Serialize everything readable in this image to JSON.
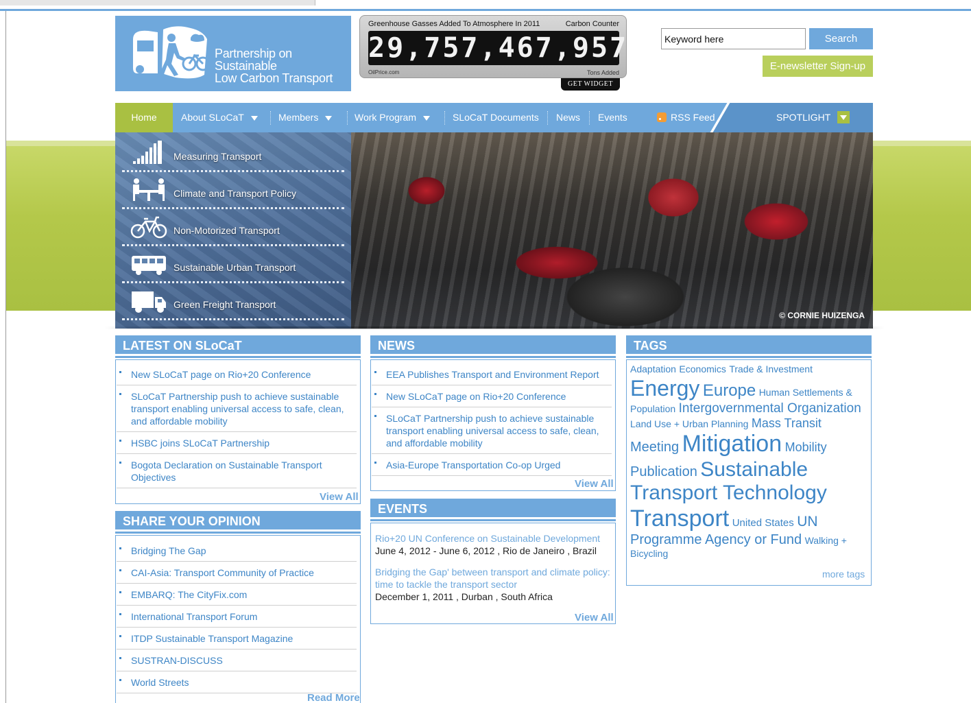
{
  "header": {
    "logo_text_line1": "Partnership on Sustainable",
    "logo_text_line2": "Low Carbon Transport",
    "counter": {
      "label_left": "Greenhouse Gasses Added To Atmosphere In 2011",
      "label_right": "Carbon Counter",
      "value": "29,757,467,957",
      "footer_left": "OilPrice.com",
      "footer_right": "Tons Added",
      "widget_label": "GET WIDGET"
    },
    "search": {
      "value": "Keyword here",
      "button_label": "Search"
    },
    "newsletter_label": "E-newsletter Sign-up"
  },
  "nav": {
    "items": [
      "Home",
      "About SLoCaT",
      "Members",
      "Work Program",
      "SLoCaT Documents",
      "News",
      "Events"
    ],
    "rss_label": "RSS Feed",
    "spotlight_label": "SPOTLIGHT"
  },
  "banner": {
    "menu": [
      "Measuring Transport",
      "Climate and Transport Policy",
      "Non-Motorized Transport",
      "Sustainable Urban Transport",
      "Green Freight Transport"
    ],
    "icons": [
      "bar-chart-icon",
      "meeting-table-icon",
      "bicycle-icon",
      "bus-icon",
      "truck-icon"
    ],
    "credit": "© CORNIE HUIZENGA"
  },
  "latest": {
    "title": "LATEST ON SLoCaT",
    "items": [
      "New SLoCaT page on Rio+20 Conference",
      "SLoCaT Partnership push to achieve sustainable transport enabling universal access to safe, clean, and affordable mobility",
      "HSBC joins SLoCaT Partnership",
      "Bogota Declaration on Sustainable Transport Objectives"
    ],
    "view_all": "View All"
  },
  "opinion": {
    "title": "SHARE YOUR OPINION",
    "items": [
      "Bridging The Gap",
      "CAI-Asia: Transport Community of Practice",
      "EMBARQ: The CityFix.com",
      "International Transport Forum",
      "ITDP Sustainable Transport Magazine",
      "SUSTRAN-DISCUSS",
      "World Streets"
    ],
    "read_more": "Read More"
  },
  "news": {
    "title": "NEWS",
    "items": [
      "EEA Publishes Transport and Environment Report",
      "New SLoCaT page on Rio+20 Conference",
      "SLoCaT Partnership push to achieve sustainable transport enabling universal access to safe, clean, and affordable mobility",
      "Asia-Europe Transportation Co-op Urged"
    ],
    "view_all": "View All"
  },
  "events": {
    "title": "EVENTS",
    "items": [
      {
        "title": "Rio+20 UN Conference on Sustainable Development",
        "details": "June 4, 2012 - June 6, 2012 , Rio de Janeiro , Brazil"
      },
      {
        "title": "Bridging the Gap' between transport and climate policy: time to tackle the transport sector",
        "details": "December 1, 2011 , Durban , South Africa"
      }
    ],
    "view_all": "View All"
  },
  "tags": {
    "title": "TAGS",
    "items": [
      {
        "label": "Adaptation",
        "size": 14
      },
      {
        "label": "Economics",
        "size": 14
      },
      {
        "label": "Trade & Investment",
        "size": 14
      },
      {
        "label": "Energy",
        "size": 32
      },
      {
        "label": "Europe",
        "size": 24
      },
      {
        "label": "Human Settlements & Population",
        "size": 14
      },
      {
        "label": "Intergovernmental Organization",
        "size": 19
      },
      {
        "label": "Land Use + Urban Planning",
        "size": 14
      },
      {
        "label": "Mass Transit",
        "size": 18
      },
      {
        "label": "Meeting",
        "size": 20
      },
      {
        "label": "Mitigation",
        "size": 34
      },
      {
        "label": "Mobility",
        "size": 18
      },
      {
        "label": "Publication",
        "size": 20
      },
      {
        "label": "Sustainable",
        "size": 30
      },
      {
        "label": "Transport Technology",
        "size": 30
      },
      {
        "label": "Transport",
        "size": 34
      },
      {
        "label": "United States",
        "size": 15
      },
      {
        "label": "UN",
        "size": 21
      },
      {
        "label": "Programme",
        "size": 20
      },
      {
        "label": "Agency or Fund",
        "size": 20
      },
      {
        "label": "Walking + Bicycling",
        "size": 14
      }
    ],
    "more_tags": "more tags"
  }
}
